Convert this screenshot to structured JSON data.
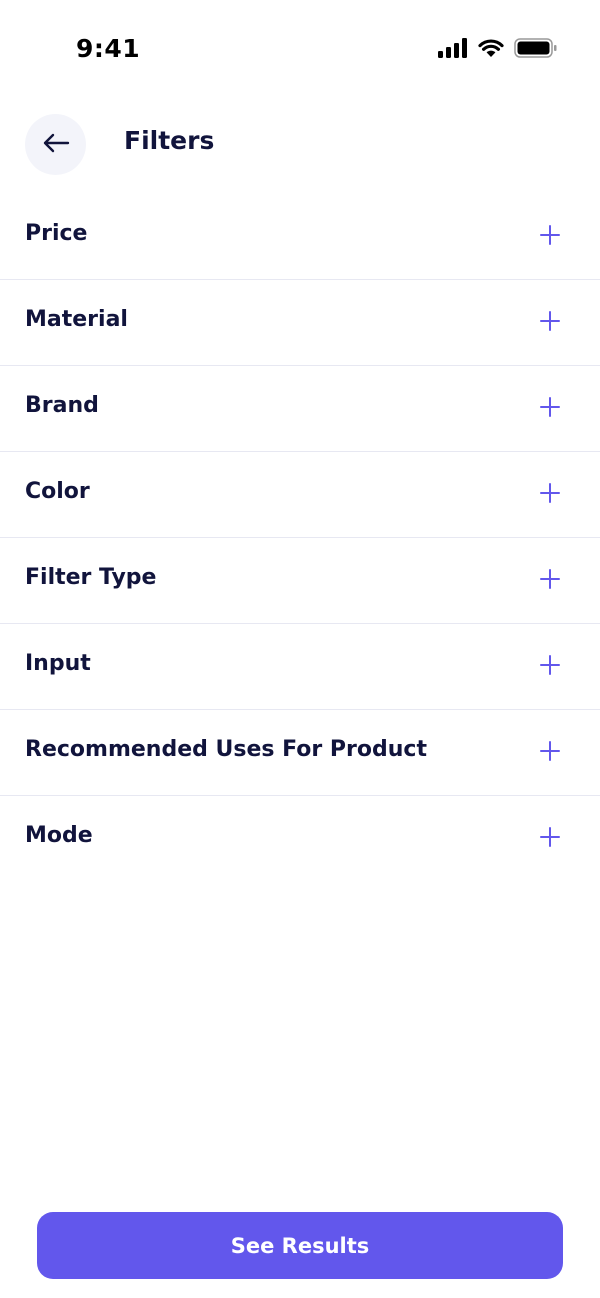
{
  "status_bar": {
    "time": "9:41",
    "icons": [
      "cellular-signal-icon",
      "wifi-icon",
      "battery-icon"
    ]
  },
  "header": {
    "title": "Filters",
    "back_icon": "arrow-left-icon"
  },
  "filters": [
    {
      "label": "Price",
      "icon": "plus-icon"
    },
    {
      "label": "Material",
      "icon": "plus-icon"
    },
    {
      "label": "Brand",
      "icon": "plus-icon"
    },
    {
      "label": "Color",
      "icon": "plus-icon"
    },
    {
      "label": "Filter Type",
      "icon": "plus-icon"
    },
    {
      "label": "Input",
      "icon": "plus-icon"
    },
    {
      "label": "Recommended Uses For Product",
      "icon": "plus-icon"
    },
    {
      "label": "Mode",
      "icon": "plus-icon"
    }
  ],
  "footer": {
    "see_results_label": "See Results"
  },
  "colors": {
    "accent": "#6257ec",
    "text_primary": "#11143c",
    "divider": "#e7e8f2",
    "back_button_bg": "#f3f4fa"
  }
}
